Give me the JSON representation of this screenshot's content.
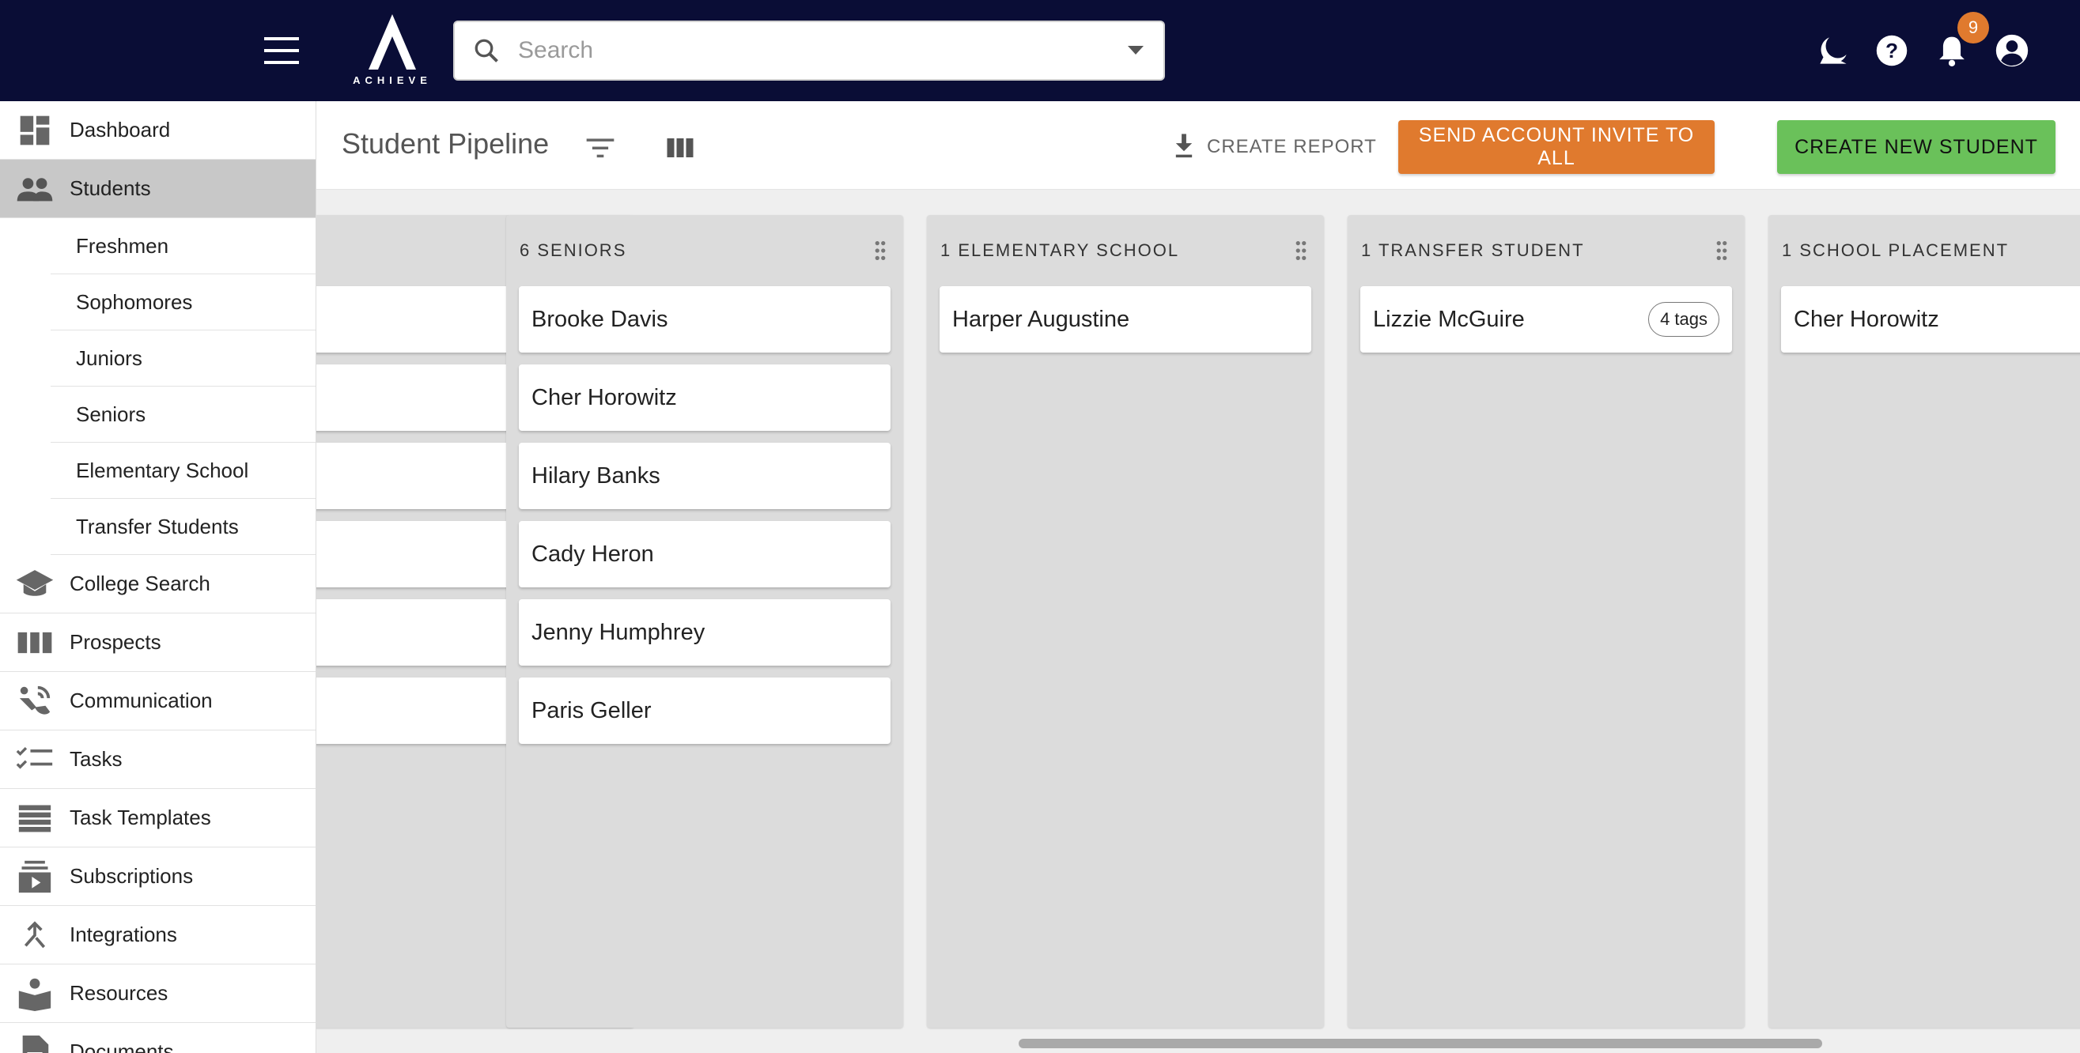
{
  "brand": {
    "logo_text": "ACHIEVE"
  },
  "search": {
    "placeholder": "Search"
  },
  "notifications": {
    "count": "9"
  },
  "sidebar": {
    "items": [
      {
        "label": "Dashboard",
        "icon": "dashboard-icon"
      },
      {
        "label": "Students",
        "icon": "people-icon",
        "active": true
      },
      {
        "label": "College Search",
        "icon": "school-icon"
      },
      {
        "label": "Prospects",
        "icon": "columns-icon"
      },
      {
        "label": "Communication",
        "icon": "communication-icon"
      },
      {
        "label": "Tasks",
        "icon": "checklist-icon"
      },
      {
        "label": "Task Templates",
        "icon": "list-icon"
      },
      {
        "label": "Subscriptions",
        "icon": "subscriptions-icon"
      },
      {
        "label": "Integrations",
        "icon": "merge-icon"
      },
      {
        "label": "Resources",
        "icon": "reader-icon"
      },
      {
        "label": "Documents",
        "icon": "document-icon"
      }
    ],
    "students_sub": [
      "Freshmen",
      "Sophomores",
      "Juniors",
      "Seniors",
      "Elementary School",
      "Transfer Students"
    ]
  },
  "header": {
    "title": "Student Pipeline",
    "create_report": "CREATE REPORT",
    "send_invite": "SEND ACCOUNT INVITE TO ALL",
    "create_student": "CREATE NEW STUDENT"
  },
  "columns": [
    {
      "title": "",
      "cards": [
        {
          "name": ""
        },
        {
          "name": ""
        },
        {
          "name": ""
        },
        {
          "name": ""
        },
        {
          "name": ""
        },
        {
          "name": ""
        }
      ]
    },
    {
      "title": "6 SENIORS",
      "cards": [
        {
          "name": "Brooke Davis"
        },
        {
          "name": "Cher Horowitz"
        },
        {
          "name": "Hilary Banks"
        },
        {
          "name": "Cady Heron"
        },
        {
          "name": "Jenny Humphrey"
        },
        {
          "name": "Paris Geller"
        }
      ]
    },
    {
      "title": "1 ELEMENTARY SCHOOL",
      "cards": [
        {
          "name": "Harper Augustine"
        }
      ]
    },
    {
      "title": "1 TRANSFER STUDENT",
      "cards": [
        {
          "name": "Lizzie McGuire",
          "tags": "4 tags"
        }
      ]
    },
    {
      "title": "1 SCHOOL PLACEMENT",
      "cards": [
        {
          "name": "Cher Horowitz"
        }
      ]
    }
  ],
  "colors": {
    "topbar": "#0a0d36",
    "orange": "#e07a2e",
    "green": "#6ac15a",
    "active_nav": "#c8c8c8"
  }
}
